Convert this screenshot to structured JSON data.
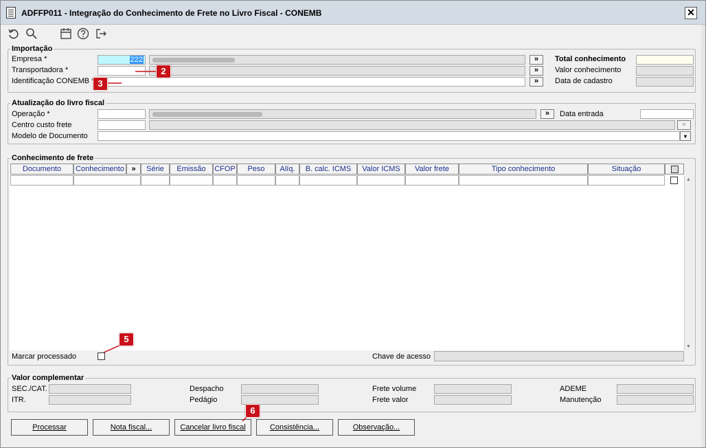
{
  "window": {
    "title": "ADFFP011 - Integração do Conhecimento de Frete no Livro Fiscal - CONEMB",
    "close": "✕"
  },
  "toolbar": {
    "icons": [
      "undo-icon",
      "search-icon",
      "calendar-icon",
      "help-icon",
      "exit-icon"
    ]
  },
  "importacao": {
    "legend": "Importação",
    "empresa_label": "Empresa *",
    "empresa_value": "222",
    "transportadora_label": "Transportadora *",
    "identificacao_label": "Identificação CONEMB *",
    "more_button": "»",
    "total_label": "Total conhecimento",
    "valor_label": "Valor conhecimento",
    "data_label": "Data de cadastro"
  },
  "atualizacao": {
    "legend": "Atualização do livro fiscal",
    "operacao_label": "Operação *",
    "centro_label": "Centro custo frete",
    "modelo_label": "Modelo de Documento",
    "data_entrada_label": "Data entrada",
    "more_button": "»"
  },
  "conhecimento": {
    "legend": "Conhecimento de frete",
    "columns": [
      "Documento",
      "Conhecimento",
      "»",
      "Série",
      "Emissão",
      "CFOP",
      "Peso",
      "Alíq.",
      "B. calc. ICMS",
      "Valor ICMS",
      "Valor frete",
      "Tipo conhecimento",
      "Situação"
    ],
    "marcar_label": "Marcar processado",
    "chave_label": "Chave de acesso"
  },
  "complementar": {
    "legend": "Valor complementar",
    "labels": [
      "SEC./CAT.",
      "ITR.",
      "Despacho",
      "Pedágio",
      "Frete volume",
      "Frete valor",
      "ADEME",
      "Manutenção"
    ]
  },
  "buttons": [
    "Processar",
    "Nota fiscal...",
    "Cancelar livro fiscal",
    "Consistência...",
    "Observação..."
  ],
  "badges": [
    "2",
    "3",
    "5",
    "6"
  ],
  "colors": {
    "badge": "#c8111a",
    "header_text": "#1a2e8a",
    "total_field": "#fffff0",
    "empresa_field": "#bff7ff"
  }
}
